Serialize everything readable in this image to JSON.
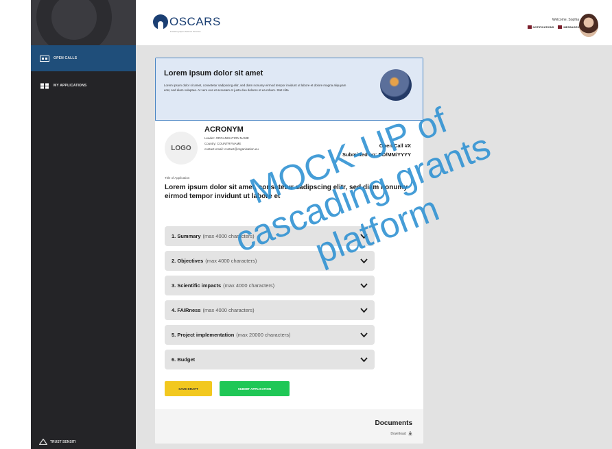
{
  "colors": {
    "sidebar_bg": "#242427",
    "sidebar_active": "#1f4e7a",
    "brand": "#1b3f73",
    "banner_border": "#4b86c4",
    "draft_button": "#f2c81f",
    "submit_button": "#1fc756",
    "watermark": "#2b90d2"
  },
  "sidebar": {
    "items": [
      {
        "label": "OPEN CALLS",
        "icon": "calendar-icon",
        "active": true
      },
      {
        "label": "MY APPLICATIONS",
        "icon": "grid-icon",
        "active": false
      }
    ],
    "footer_label": "TRUST SENSITI"
  },
  "header": {
    "logo_text": "OSCARS",
    "logo_subtitle": "Fostering Open Science Services",
    "welcome": "Welcome, Sophia",
    "notifications_label": "NOTIFICATIONS",
    "messages_label": "MESSAGES"
  },
  "banner": {
    "title": "Lorem ipsum dolor sit amet",
    "text": "Lorem ipsum dolor sit amet, consetetur sadipscing elitr, sed diam nonumy eirmod tempor invidunt ut labore et dolore magna aliquyam erat, sed diam voluptua. At vero eos et accusam et justo duo dolores et ea rebum. Stet clita"
  },
  "applicant": {
    "logo_placeholder": "LOGO",
    "acronym": "ACRONYM",
    "leader": "Leader: ORGANISATION NAME",
    "country": "Country: COUNTRYNAME",
    "email": "contact email: contact@organisation.eu",
    "open_call": "Open Call #X",
    "submitted": "Submitted on: DD/MM/YYYY"
  },
  "application": {
    "title_label": "Title of Application",
    "title": "Lorem ipsum dolor sit amet, consetetur sadipscing elitr, sed diam nonumy eirmod tempor invidunt ut labore et"
  },
  "sections": [
    {
      "label": "1. Summary",
      "hint": "(max 4000 characters)"
    },
    {
      "label": "2. Objectives",
      "hint": "(max 4000 characters)"
    },
    {
      "label": "3. Scientific impacts",
      "hint": "(max 4000 characters)"
    },
    {
      "label": "4. FAIRness",
      "hint": "(max 4000 characters)"
    },
    {
      "label": "5. Project implementation",
      "hint": "(max 20000 characters)"
    },
    {
      "label": "6. Budget",
      "hint": ""
    }
  ],
  "actions": {
    "save_draft": "SAVE DRAFT",
    "submit": "SUBMIT APPLICATION"
  },
  "documents": {
    "title": "Documents",
    "download": "Download"
  },
  "watermark": {
    "line1": "MOCK-UP of",
    "line2": "cascading grants",
    "line3": "platform"
  }
}
